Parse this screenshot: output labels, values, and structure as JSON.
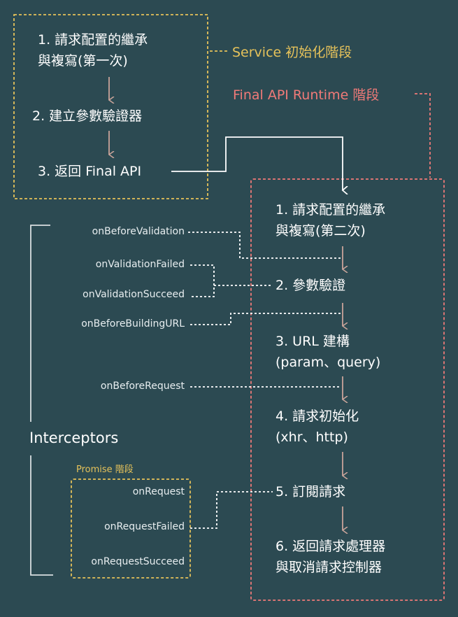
{
  "service": {
    "title": "Service 初始化階段",
    "step1": "1. 請求配置的繼承\n與複寫(第一次)",
    "step2": "2. 建立參數驗證器",
    "step3": "3. 返回 Final API"
  },
  "runtime": {
    "title": "Final API Runtime 階段",
    "step1": "1. 請求配置的繼承\n與複寫(第二次)",
    "step2": "2. 參數驗證",
    "step3": "3. URL 建構\n(param、query)",
    "step4": "4. 請求初始化\n(xhr、http)",
    "step5": "5. 訂閱請求",
    "step6": "6. 返回請求處理器\n與取消請求控制器"
  },
  "interceptors": {
    "label": "Interceptors",
    "hooks": [
      "onBeforeValidation",
      "onValidationFailed",
      "onValidationSucceed",
      "onBeforeBuildingURL",
      "onBeforeRequest"
    ],
    "promise": {
      "title": "Promise 階段",
      "hooks": [
        "onRequest",
        "onRequestFailed",
        "onRequestSucceed"
      ]
    }
  },
  "colors": {
    "background": "#2c4a52",
    "service_border": "#e6c25a",
    "runtime_border": "#f07a78",
    "arrow": "#c9a49a",
    "connector": "#ffffff",
    "bracket": "#d9dfe1"
  }
}
